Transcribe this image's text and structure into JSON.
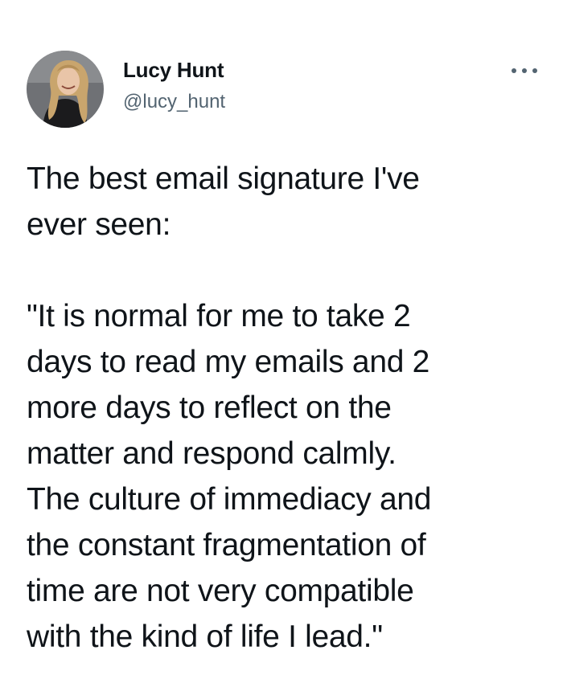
{
  "tweet": {
    "author": {
      "display_name": "Lucy Hunt",
      "handle": "@lucy_hunt"
    },
    "more_icon": "more-horizontal-icon",
    "paragraphs": [
      "The best email signature I've\never seen:",
      "\"It is normal for me to take 2\ndays to read my emails and 2\nmore days to reflect on the\nmatter and respond calmly.\nThe culture of immediacy and\nthe constant fragmentation of\ntime are not very compatible\nwith the kind of life I lead.\""
    ]
  },
  "colors": {
    "text_primary": "#0f1419",
    "text_secondary": "#536471",
    "background": "#ffffff"
  }
}
